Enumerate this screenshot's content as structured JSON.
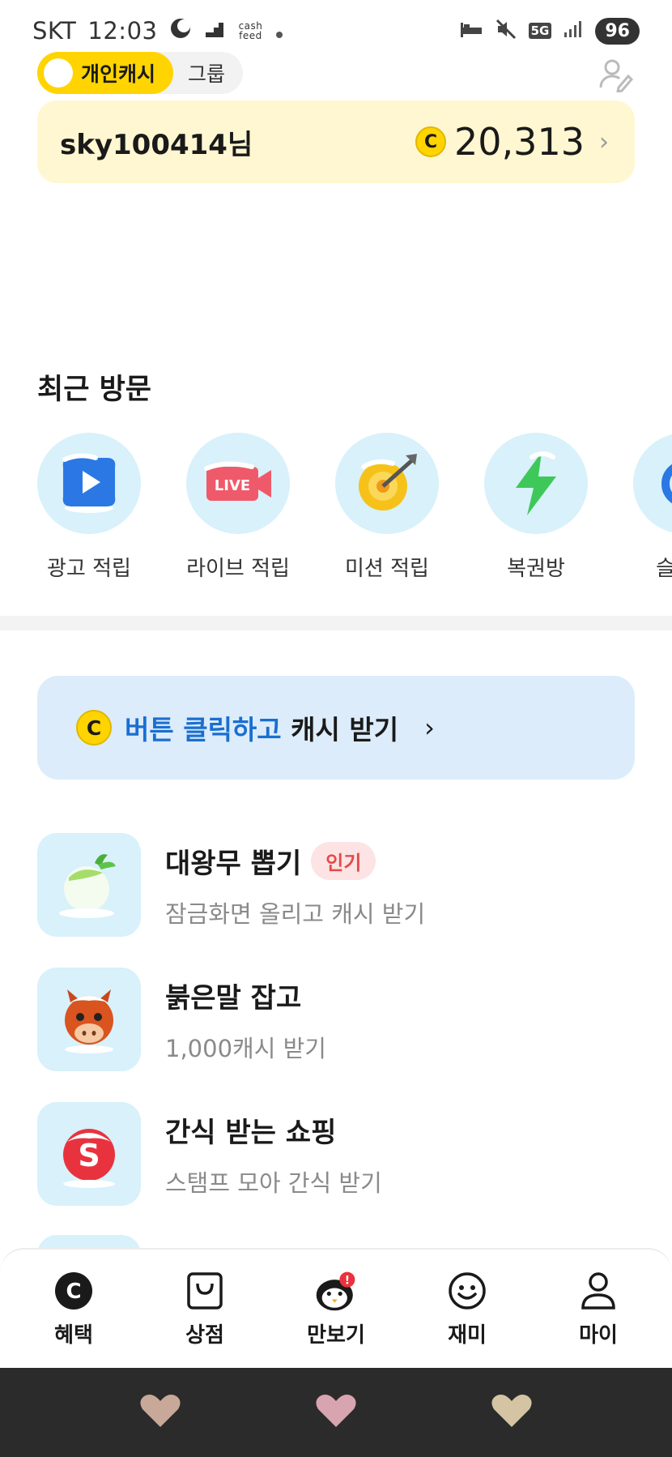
{
  "status_bar": {
    "carrier": "SKT",
    "time": "12:03",
    "app_badge": "cash feed",
    "network": "5G",
    "battery": "96"
  },
  "toggle": {
    "active_label": "개인캐시",
    "inactive_label": "그룹"
  },
  "cash_card": {
    "user": "sky100414님",
    "coin_symbol": "C",
    "amount": "20,313"
  },
  "recent": {
    "title": "최근 방문",
    "items": [
      {
        "label": "광고 적립",
        "icon": "play-icon"
      },
      {
        "label": "라이브 적립",
        "icon": "live-icon"
      },
      {
        "label": "미션 적립",
        "icon": "target-icon"
      },
      {
        "label": "복권방",
        "icon": "lightning-icon"
      },
      {
        "label": "슬라이",
        "icon": "slide-icon"
      }
    ],
    "live_text": "LIVE"
  },
  "banner": {
    "coin_symbol": "C",
    "highlight": "버튼 클릭하고",
    "rest": " 캐시 받기"
  },
  "list": [
    {
      "title": "대왕무 뽑기",
      "badge": "인기",
      "subtitle": "잠금화면 올리고 캐시 받기"
    },
    {
      "title": "붉은말 잡고",
      "badge": "",
      "subtitle": "1,000캐시 받기"
    },
    {
      "title": "간식 받는 쇼핑",
      "badge": "",
      "subtitle": "스탬프 모아 간식 받기",
      "icon_letter": "S"
    }
  ],
  "bottom_nav": [
    {
      "label": "혜택",
      "icon": "benefit-icon",
      "glyph": "C"
    },
    {
      "label": "상점",
      "icon": "shop-bag-icon"
    },
    {
      "label": "만보기",
      "icon": "pedometer-penguin-icon",
      "alert": "!"
    },
    {
      "label": "재미",
      "icon": "smile-icon"
    },
    {
      "label": "마이",
      "icon": "person-icon"
    }
  ],
  "colors": {
    "accent_yellow": "#ffd400",
    "card_yellow": "#fff7d1",
    "banner_blue_bg": "#dcecfb",
    "link_blue": "#1a6fd0",
    "thumb_bg": "#d8f1fa",
    "badge_red": "#e34b4b"
  }
}
